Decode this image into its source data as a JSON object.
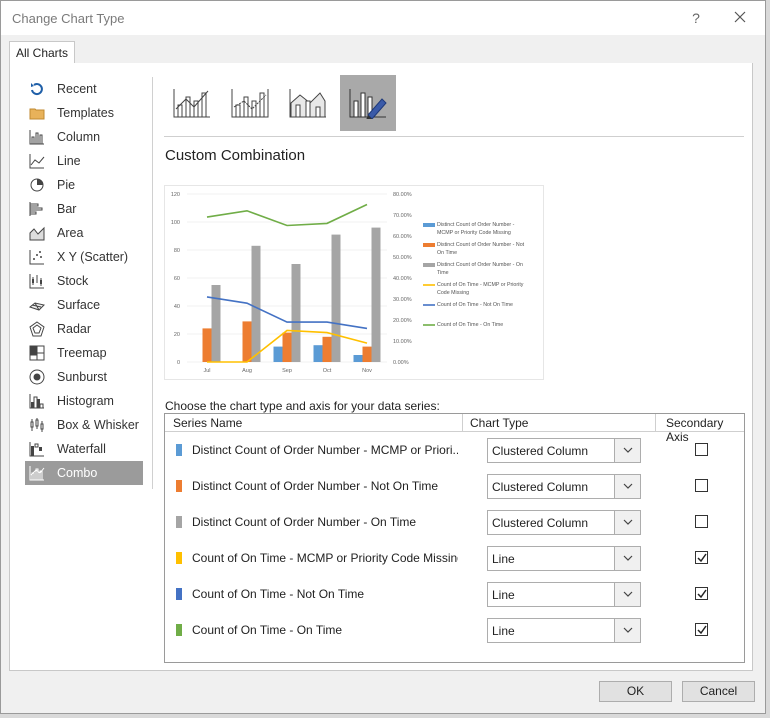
{
  "window": {
    "title": "Change Chart Type",
    "help": "?"
  },
  "tabs": [
    {
      "label": "All Charts"
    }
  ],
  "chart_types": [
    {
      "label": "Recent",
      "icon": "recent-icon"
    },
    {
      "label": "Templates",
      "icon": "folder-icon"
    },
    {
      "label": "Column",
      "icon": "column-chart-icon"
    },
    {
      "label": "Line",
      "icon": "line-chart-icon"
    },
    {
      "label": "Pie",
      "icon": "pie-chart-icon"
    },
    {
      "label": "Bar",
      "icon": "bar-chart-icon"
    },
    {
      "label": "Area",
      "icon": "area-chart-icon"
    },
    {
      "label": "X Y (Scatter)",
      "icon": "scatter-chart-icon"
    },
    {
      "label": "Stock",
      "icon": "stock-chart-icon"
    },
    {
      "label": "Surface",
      "icon": "surface-chart-icon"
    },
    {
      "label": "Radar",
      "icon": "radar-chart-icon"
    },
    {
      "label": "Treemap",
      "icon": "treemap-icon"
    },
    {
      "label": "Sunburst",
      "icon": "sunburst-icon"
    },
    {
      "label": "Histogram",
      "icon": "histogram-icon"
    },
    {
      "label": "Box & Whisker",
      "icon": "box-whisker-icon"
    },
    {
      "label": "Waterfall",
      "icon": "waterfall-icon"
    },
    {
      "label": "Combo",
      "icon": "combo-chart-icon",
      "selected": true
    }
  ],
  "subtypes": [
    {
      "icon": "clustered-column-line-icon"
    },
    {
      "icon": "clustered-column-line-secondary-icon"
    },
    {
      "icon": "stacked-area-clustered-column-icon"
    },
    {
      "icon": "custom-combination-icon",
      "selected": true
    }
  ],
  "combo_title": "Custom Combination",
  "chart_data": {
    "type": "bar",
    "categories": [
      "Jul",
      "Aug",
      "Sep",
      "Oct",
      "Nov"
    ],
    "primary_axis": {
      "ylim": [
        0,
        120
      ],
      "ticks": [
        "0",
        "20",
        "40",
        "60",
        "80",
        "100",
        "120"
      ]
    },
    "secondary_axis": {
      "ylim": [
        0,
        0.8
      ],
      "ticks": [
        "0.00%",
        "10.00%",
        "20.00%",
        "30.00%",
        "40.00%",
        "50.00%",
        "60.00%",
        "70.00%",
        "80.00%"
      ]
    },
    "series": [
      {
        "name": "Distinct Count of Order Number - MCMP or Priority Code Missing",
        "kind": "column",
        "axis": "primary",
        "color": "#5b9bd5",
        "values": [
          0,
          0,
          11,
          12,
          5
        ]
      },
      {
        "name": "Distinct Count of Order Number - Not On Time",
        "kind": "column",
        "axis": "primary",
        "color": "#ed7d31",
        "values": [
          24,
          29,
          21,
          18,
          11
        ]
      },
      {
        "name": "Distinct Count of Order Number - On Time",
        "kind": "column",
        "axis": "primary",
        "color": "#a5a5a5",
        "values": [
          55,
          83,
          70,
          91,
          96
        ]
      },
      {
        "name": "Count of On Time - MCMP or Priority Code Missing",
        "kind": "line",
        "axis": "secondary",
        "color": "#ffc000",
        "values": [
          0,
          0,
          0.15,
          0.14,
          0.09
        ]
      },
      {
        "name": "Count of On Time - Not On Time",
        "kind": "line",
        "axis": "secondary",
        "color": "#4472c4",
        "values": [
          0.31,
          0.28,
          0.19,
          0.19,
          0.16
        ]
      },
      {
        "name": "Count of On Time - On Time",
        "kind": "line",
        "axis": "secondary",
        "color": "#70ad47",
        "values": [
          0.69,
          0.72,
          0.65,
          0.66,
          0.75
        ]
      }
    ],
    "legend_position": "right"
  },
  "legend_lines": [
    [
      "Distinct Count of Order Number -",
      "MCMP or Priority Code Missing"
    ],
    [
      "Distinct Count of Order Number - Not",
      "On Time"
    ],
    [
      "Distinct Count of Order Number - On",
      "Time"
    ],
    [
      "Count of On Time - MCMP or Priority",
      "Code Missing"
    ],
    [
      "Count of On Time - Not On Time"
    ],
    [
      "Count of On Time - On Time"
    ]
  ],
  "series_table": {
    "label": "Choose the chart type and axis for your data series:",
    "headers": {
      "name": "Series Name",
      "type": "Chart Type",
      "secondary": "Secondary Axis"
    },
    "rows": [
      {
        "name": "Distinct Count of Order Number - MCMP or Priori...",
        "color": "#5b9bd5",
        "chart_type": "Clustered Column",
        "secondary": false
      },
      {
        "name": "Distinct Count of Order Number - Not On Time",
        "color": "#ed7d31",
        "chart_type": "Clustered Column",
        "secondary": false
      },
      {
        "name": "Distinct Count of Order Number - On Time",
        "color": "#a5a5a5",
        "chart_type": "Clustered Column",
        "secondary": false
      },
      {
        "name": "Count of On Time - MCMP or Priority Code Missing",
        "color": "#ffc000",
        "chart_type": "Line",
        "secondary": true
      },
      {
        "name": "Count of On Time - Not On Time",
        "color": "#4472c4",
        "chart_type": "Line",
        "secondary": true
      },
      {
        "name": "Count of On Time - On Time",
        "color": "#70ad47",
        "chart_type": "Line",
        "secondary": true
      }
    ]
  },
  "buttons": {
    "ok": "OK",
    "cancel": "Cancel"
  }
}
